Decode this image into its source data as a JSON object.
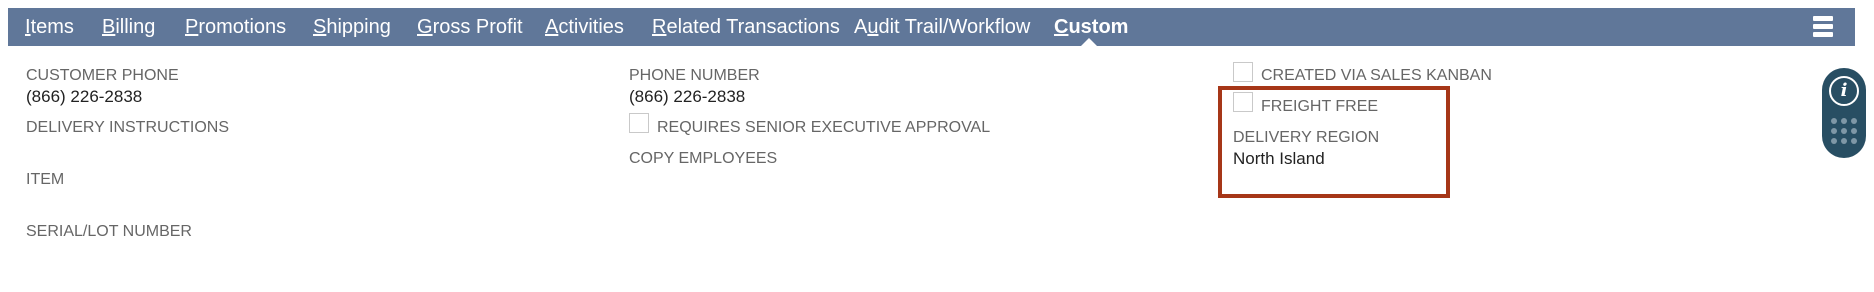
{
  "tabs": [
    {
      "label": "Items",
      "accel": "I"
    },
    {
      "label": "Billing",
      "accel": "B"
    },
    {
      "label": "Promotions",
      "accel": "P"
    },
    {
      "label": "Shipping",
      "accel": "S"
    },
    {
      "label": "Gross Profit",
      "accel": "G"
    },
    {
      "label": "Activities",
      "accel": "A"
    },
    {
      "label": "Related Transactions",
      "accel": "R"
    },
    {
      "label": "Audit Trail/Workflow",
      "accel": "u"
    },
    {
      "label": "Custom",
      "accel": "C",
      "active": true
    }
  ],
  "col1": {
    "customer_phone_label": "CUSTOMER PHONE",
    "customer_phone_value": "(866) 226-2838",
    "delivery_instructions_label": "DELIVERY INSTRUCTIONS",
    "item_label": "ITEM",
    "serial_label": "SERIAL/LOT NUMBER"
  },
  "col2": {
    "phone_number_label": "PHONE NUMBER",
    "phone_number_value": "(866) 226-2838",
    "requires_approval_label": "REQUIRES SENIOR EXECUTIVE APPROVAL",
    "requires_approval_checked": false,
    "copy_employees_label": "COPY EMPLOYEES"
  },
  "col3": {
    "created_via_kanban_label": "CREATED VIA SALES KANBAN",
    "created_via_kanban_checked": false,
    "freight_free_label": "FREIGHT FREE",
    "freight_free_checked": false,
    "delivery_region_label": "DELIVERY REGION",
    "delivery_region_value": "North Island"
  },
  "colors": {
    "tabbar": "#607799",
    "highlight": "#a63618",
    "side_widget": "#284e63"
  },
  "icons": {
    "menu": "hamburger-menu-icon",
    "info": "info-icon",
    "grid": "grid-dots-icon"
  }
}
